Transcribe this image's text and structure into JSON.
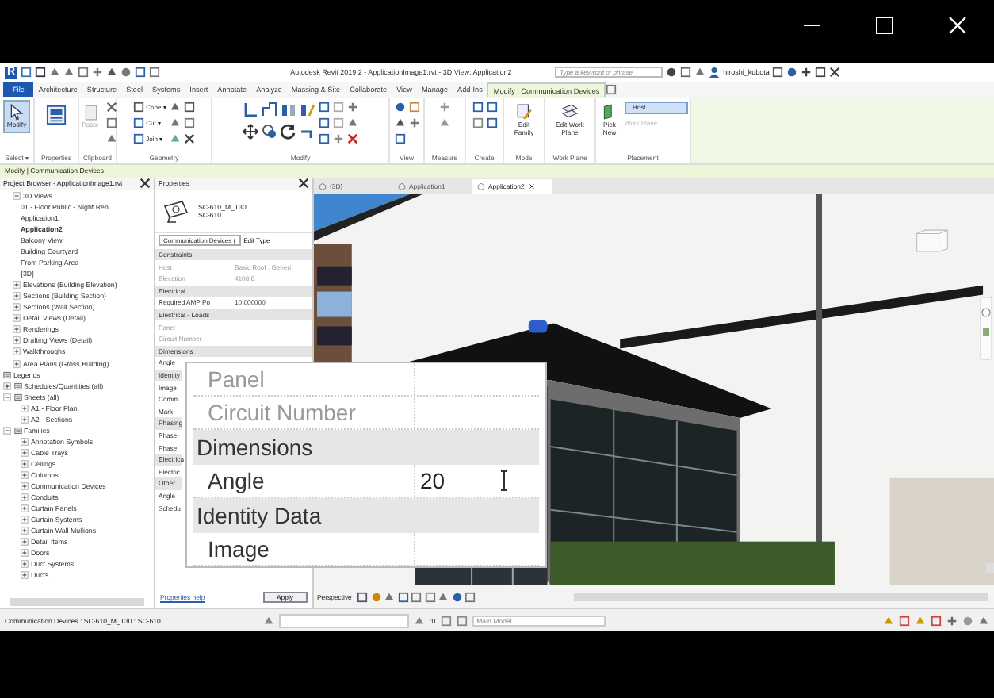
{
  "title_bar": {
    "logo": "R",
    "title": "Autodesk Revit 2019.2 - ApplicationImage1.rvt - 3D View: Application2",
    "search": {
      "placeholder": "Type a keyword or phrase"
    },
    "user": "hiroshi_kubota"
  },
  "ribbon_tabs": [
    {
      "label": "File",
      "kind": "file",
      "selected": false
    },
    {
      "label": "Architecture",
      "kind": "tab",
      "selected": false
    },
    {
      "label": "Structure",
      "kind": "tab",
      "selected": false
    },
    {
      "label": "Steel",
      "kind": "tab",
      "selected": false
    },
    {
      "label": "Systems",
      "kind": "tab",
      "selected": false
    },
    {
      "label": "Insert",
      "kind": "tab",
      "selected": false
    },
    {
      "label": "Annotate",
      "kind": "tab",
      "selected": false
    },
    {
      "label": "Analyze",
      "kind": "tab",
      "selected": false
    },
    {
      "label": "Massing & Site",
      "kind": "tab",
      "selected": false
    },
    {
      "label": "Collaborate",
      "kind": "tab",
      "selected": false
    },
    {
      "label": "View",
      "kind": "tab",
      "selected": false
    },
    {
      "label": "Manage",
      "kind": "tab",
      "selected": false
    },
    {
      "label": "Add-Ins",
      "kind": "tab",
      "selected": false
    },
    {
      "label": "Modify | Communication Devices",
      "kind": "tab",
      "selected": true
    }
  ],
  "ribbon_panels": [
    {
      "label": "Select ▾"
    },
    {
      "label": "Properties"
    },
    {
      "label": "Clipboard"
    },
    {
      "label": "Geometry"
    },
    {
      "label": "Modify"
    },
    {
      "label": "View"
    },
    {
      "label": "Measure"
    },
    {
      "label": "Create"
    },
    {
      "label": "Mode"
    },
    {
      "label": "Work Plane"
    },
    {
      "label": "Placement"
    }
  ],
  "ribbon_tools": {
    "modify": {
      "label": "Modify",
      "selected": true
    },
    "paste": {
      "label": "Paste",
      "disabled": true
    },
    "cope": "Cope ▾",
    "cut": "Cut ▾",
    "join": "Join ▾",
    "edit_family": "Edit Family",
    "edit_work_plane": "Edit Work Plane",
    "pick_new": "Pick New",
    "host": {
      "label": "Host",
      "selected": true
    },
    "work_plane": {
      "label": "Work Plane",
      "disabled": true
    }
  },
  "context_bar": "Modify | Communication Devices",
  "project_browser": {
    "title": "Project Browser - ApplicationImage1.rvt",
    "tree": [
      {
        "label": "3D Views",
        "kind": "folder",
        "expanded": true,
        "children": [
          {
            "label": "01 - Floor Public - Night Ren",
            "kind": "item",
            "selected": false
          },
          {
            "label": "Application1",
            "kind": "item",
            "selected": false
          },
          {
            "label": "Application2",
            "kind": "item",
            "selected": true
          },
          {
            "label": "Balcony View",
            "kind": "item",
            "selected": false
          },
          {
            "label": "Building Courtyard",
            "kind": "item",
            "selected": false
          },
          {
            "label": "From Parking Area",
            "kind": "item",
            "selected": false
          },
          {
            "label": "{3D}",
            "kind": "item",
            "selected": false
          }
        ]
      },
      {
        "label": "Elevations (Building Elevation)",
        "kind": "folder",
        "expanded": false
      },
      {
        "label": "Sections (Building Section)",
        "kind": "folder",
        "expanded": false
      },
      {
        "label": "Sections (Wall Section)",
        "kind": "folder",
        "expanded": false
      },
      {
        "label": "Detail Views (Detail)",
        "kind": "folder",
        "expanded": false
      },
      {
        "label": "Renderings",
        "kind": "folder",
        "expanded": false
      },
      {
        "label": "Drafting Views (Detail)",
        "kind": "folder",
        "expanded": false
      },
      {
        "label": "Walkthroughs",
        "kind": "folder",
        "expanded": false
      },
      {
        "label": "Area Plans (Gross Building)",
        "kind": "folder",
        "expanded": false
      },
      {
        "label": "Legends",
        "kind": "legend"
      },
      {
        "label": "Schedules/Quantities (all)",
        "kind": "category",
        "expanded": false
      },
      {
        "label": "Sheets (all)",
        "kind": "category",
        "expanded": true,
        "children": [
          {
            "label": "A1 - Floor Plan",
            "kind": "folder",
            "expanded": false
          },
          {
            "label": "A2 - Sections",
            "kind": "folder",
            "expanded": false
          }
        ]
      },
      {
        "label": "Families",
        "kind": "category",
        "expanded": true,
        "children": [
          {
            "label": "Annotation Symbols",
            "kind": "folder",
            "expanded": false
          },
          {
            "label": "Cable Trays",
            "kind": "folder",
            "expanded": false
          },
          {
            "label": "Ceilings",
            "kind": "folder",
            "expanded": false
          },
          {
            "label": "Columns",
            "kind": "folder",
            "expanded": false
          },
          {
            "label": "Communication Devices",
            "kind": "folder",
            "expanded": false
          },
          {
            "label": "Conduits",
            "kind": "folder",
            "expanded": false
          },
          {
            "label": "Curtain Panels",
            "kind": "folder",
            "expanded": false
          },
          {
            "label": "Curtain Systems",
            "kind": "folder",
            "expanded": false
          },
          {
            "label": "Curtain Wall Mullions",
            "kind": "folder",
            "expanded": false
          },
          {
            "label": "Detail Items",
            "kind": "folder",
            "expanded": false
          },
          {
            "label": "Doors",
            "kind": "folder",
            "expanded": false
          },
          {
            "label": "Duct Systems",
            "kind": "folder",
            "expanded": false
          },
          {
            "label": "Ducts",
            "kind": "folder",
            "expanded": false
          }
        ]
      }
    ]
  },
  "properties": {
    "title": "Properties",
    "type_name": "SC-610_M_T30",
    "type_sub": "SC-610",
    "selector": "Communication Devices (",
    "edit_type": "Edit Type",
    "rows": [
      {
        "kind": "header",
        "label": "Constraints"
      },
      {
        "kind": "row",
        "label": "Host",
        "value": "Basic Roof : Generi",
        "disabled": true
      },
      {
        "kind": "row",
        "label": "Elevation",
        "value": "4108.6",
        "disabled": true
      },
      {
        "kind": "header",
        "label": "Electrical"
      },
      {
        "kind": "row",
        "label": "Required AMP Po",
        "value": "10.000000",
        "disabled": false
      },
      {
        "kind": "header",
        "label": "Electrical - Loads"
      },
      {
        "kind": "row",
        "label": "Panel",
        "disabled": true
      },
      {
        "kind": "row",
        "label": "Circuit Number",
        "disabled": true
      },
      {
        "kind": "header",
        "label": "Dimensions"
      },
      {
        "kind": "row",
        "label": "Angle",
        "disabled": false
      },
      {
        "kind": "header",
        "label": "Identity"
      },
      {
        "kind": "row",
        "label": "Image",
        "disabled": false
      },
      {
        "kind": "row",
        "label": "Comm",
        "disabled": false
      },
      {
        "kind": "row",
        "label": "Mark",
        "disabled": false
      },
      {
        "kind": "header",
        "label": "Phasing"
      },
      {
        "kind": "row",
        "label": "Phase",
        "disabled": false
      },
      {
        "kind": "row",
        "label": "Phase",
        "disabled": false
      },
      {
        "kind": "header",
        "label": "Electrica"
      },
      {
        "kind": "row",
        "label": "Electric",
        "disabled": false
      },
      {
        "kind": "header",
        "label": "Other"
      },
      {
        "kind": "row",
        "label": "Angle",
        "disabled": false
      },
      {
        "kind": "row",
        "label": "Schedu",
        "disabled": false
      }
    ],
    "help": "Properties help",
    "apply": "Apply"
  },
  "magnifier": {
    "rows": [
      {
        "kind": "row",
        "label": "Panel",
        "disabled": true
      },
      {
        "kind": "row",
        "label": "Circuit Number",
        "disabled": true
      },
      {
        "kind": "header",
        "label": "Dimensions"
      },
      {
        "kind": "row",
        "label": "Angle",
        "value": "20",
        "disabled": false
      },
      {
        "kind": "header",
        "label": "Identity Data"
      },
      {
        "kind": "row",
        "label": "Image",
        "disabled": false
      }
    ]
  },
  "view_tabs": [
    {
      "label": "{3D}",
      "selected": false
    },
    {
      "label": "Application1",
      "selected": false
    },
    {
      "label": "Application2",
      "selected": true
    }
  ],
  "view_control": {
    "label": "Perspective"
  },
  "status_bar": {
    "text": "Communication Devices : SC-610_M_T30 : SC-610",
    "count": ":0",
    "model": "Main Model"
  }
}
